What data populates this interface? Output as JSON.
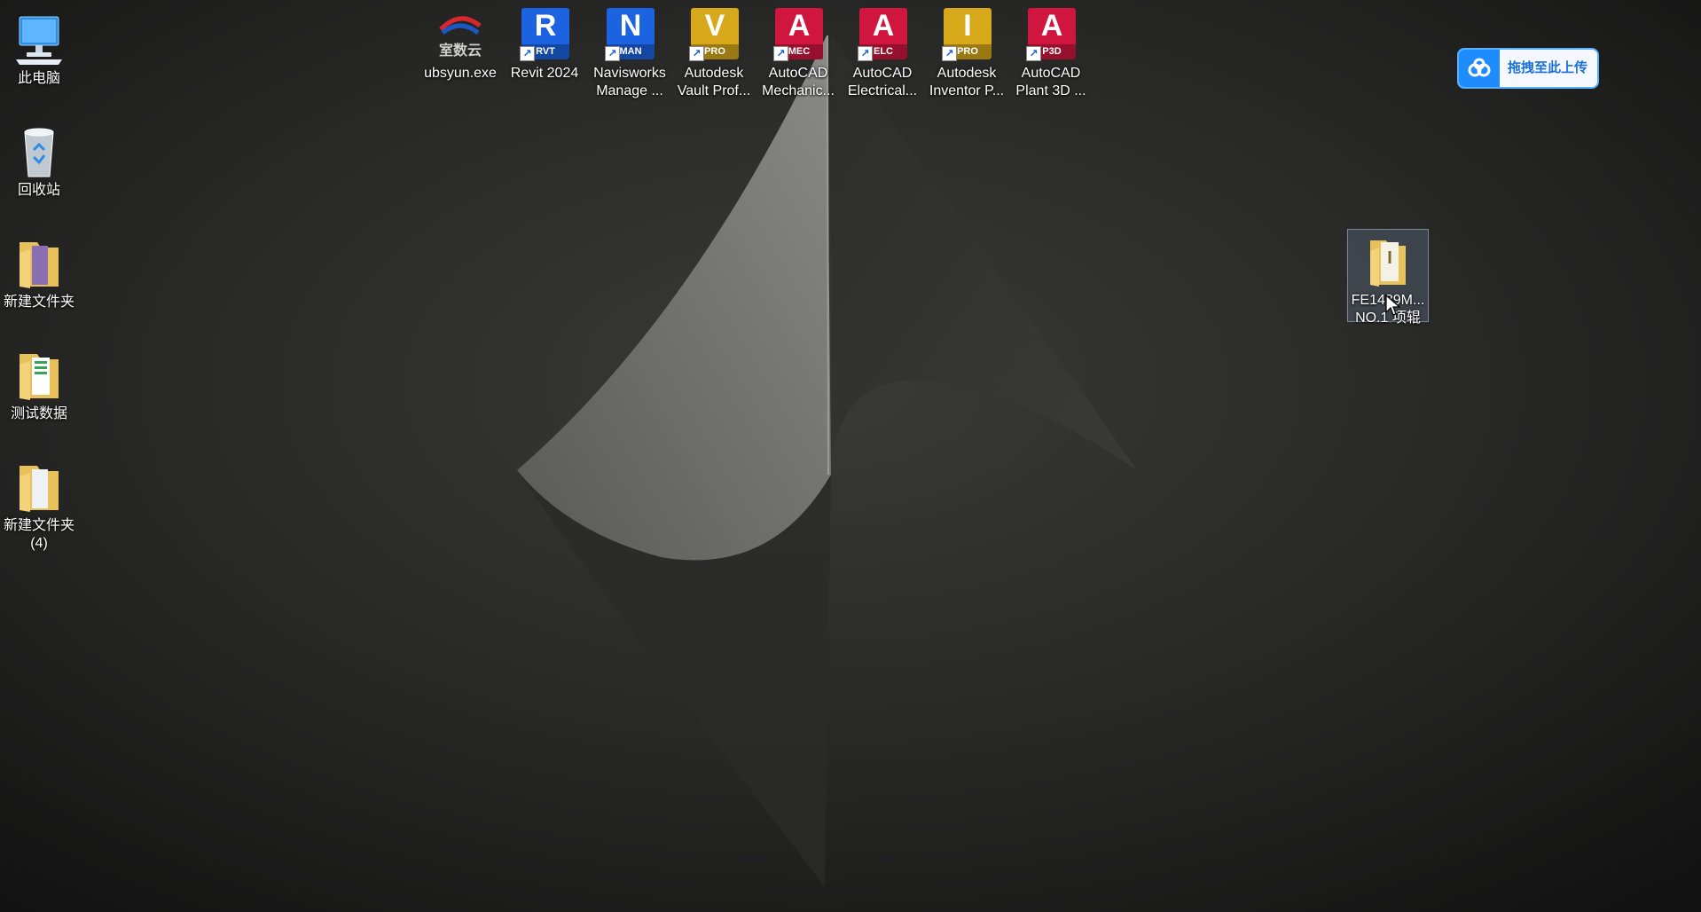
{
  "desktop": {
    "left_column": [
      {
        "label": "此电脑",
        "icon": "computer-icon"
      },
      {
        "label": "回收站",
        "icon": "recycle-bin-icon"
      },
      {
        "label": "新建文件夹",
        "icon": "folder-icon"
      },
      {
        "label": "测试数据",
        "icon": "folder-icon"
      },
      {
        "label": "新建文件夹",
        "label2": "(4)",
        "icon": "folder-icon"
      }
    ],
    "top_row": [
      {
        "label": "ubsyun.exe",
        "label2": "",
        "icon": "ubsyun-icon",
        "logo_text": "室数云"
      },
      {
        "label": "Revit 2024",
        "label2": "",
        "icon": "revit-icon",
        "letter": "R",
        "tag": "RVT",
        "color": "#1b63e0"
      },
      {
        "label": "Navisworks",
        "label2": "Manage ...",
        "icon": "navisworks-icon",
        "letter": "N",
        "tag": "MAN",
        "color": "#1b63e0"
      },
      {
        "label": "Autodesk",
        "label2": "Vault Prof...",
        "icon": "vault-icon",
        "letter": "V",
        "tag": "PRO",
        "color": "#d6a81a"
      },
      {
        "label": "AutoCAD",
        "label2": "Mechanic...",
        "icon": "autocad-mechanical-icon",
        "letter": "A",
        "tag": "MEC",
        "color": "#d0153e"
      },
      {
        "label": "AutoCAD",
        "label2": "Electrical...",
        "icon": "autocad-electrical-icon",
        "letter": "A",
        "tag": "ELC",
        "color": "#d0153e"
      },
      {
        "label": "Autodesk",
        "label2": "Inventor P...",
        "icon": "inventor-icon",
        "letter": "I",
        "tag": "PRO",
        "color": "#d6a81a"
      },
      {
        "label": "AutoCAD",
        "label2": "Plant 3D ...",
        "icon": "autocad-plant3d-icon",
        "letter": "A",
        "tag": "P3D",
        "color": "#d0153e"
      }
    ],
    "selected_file": {
      "label": "FE1489M...",
      "label2": "NO.1 项辊",
      "icon": "inventor-folder-icon"
    }
  },
  "upload_widget": {
    "label": "拖拽至此上传",
    "icon": "cloud-upload-icon",
    "accent": "#1e8cff"
  }
}
